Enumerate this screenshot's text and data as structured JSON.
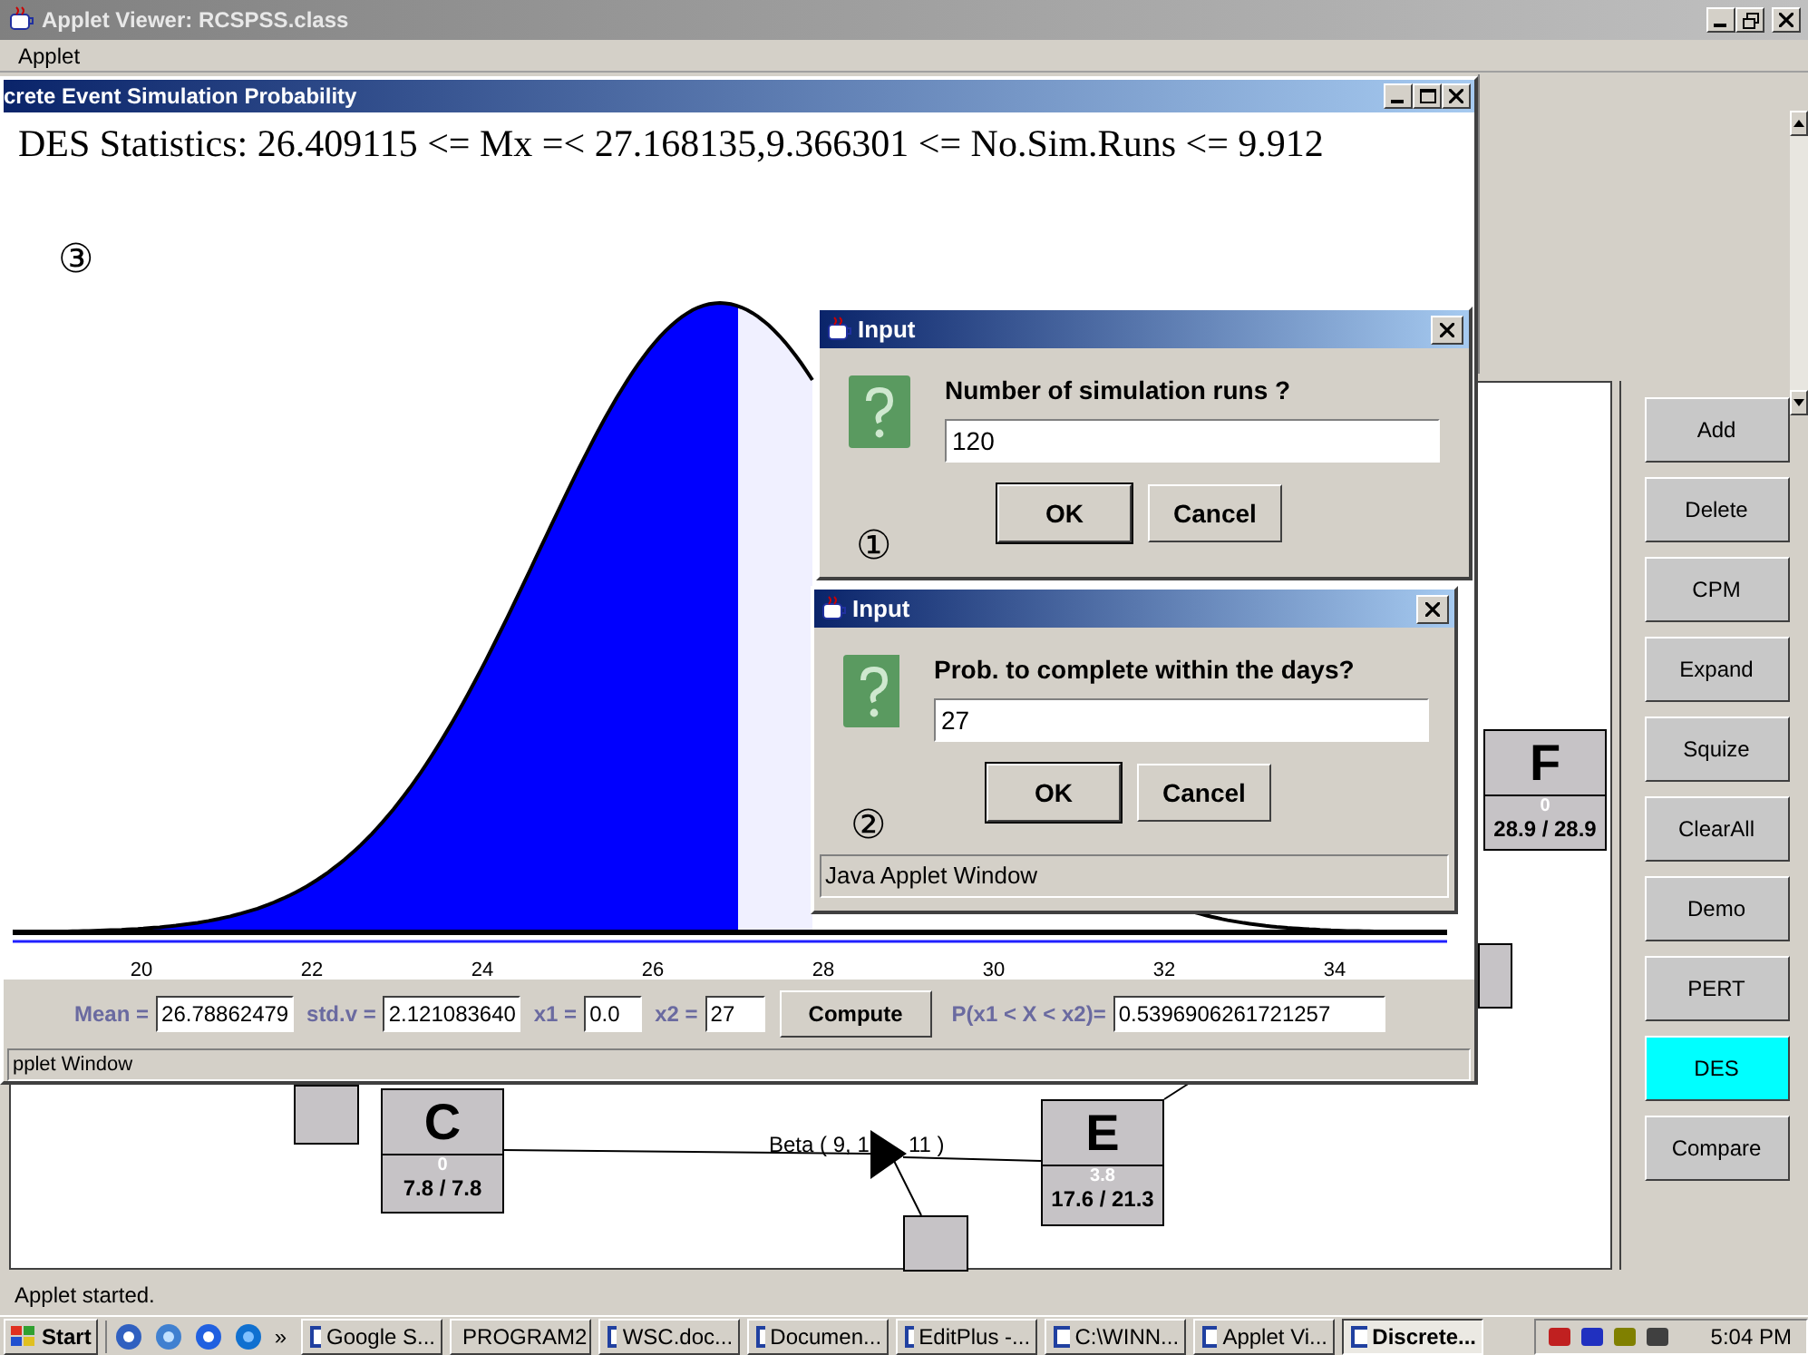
{
  "applet_viewer": {
    "title": "Applet Viewer: RCSPSS.class",
    "menu": [
      "Applet"
    ],
    "status": "Applet started."
  },
  "network": {
    "nodes": [
      {
        "label": "C",
        "value": "0",
        "times": "7.8 / 7.8"
      },
      {
        "label": "E",
        "value": "3.8",
        "times": "17.6 / 21.3"
      },
      {
        "label": "F",
        "value": "0",
        "times": "28.9 / 28.9"
      }
    ],
    "edge_label": [
      "Beta ( 9, 1",
      "11 )"
    ]
  },
  "side_buttons": [
    {
      "label": "Add",
      "selected": false
    },
    {
      "label": "Delete",
      "selected": false
    },
    {
      "label": "CPM",
      "selected": false
    },
    {
      "label": "Expand",
      "selected": false
    },
    {
      "label": "Squize",
      "selected": false
    },
    {
      "label": "ClearAll",
      "selected": false
    },
    {
      "label": "Demo",
      "selected": false
    },
    {
      "label": "PERT",
      "selected": false
    },
    {
      "label": "DES",
      "selected": true
    },
    {
      "label": "Compare",
      "selected": false
    }
  ],
  "des_window": {
    "title": "crete Event Simulation Probability",
    "statistics": "DES Statistics: 26.409115 <= Mx =< 27.168135,9.366301 <= No.Sim.Runs <= 9.912",
    "step_mark": "③",
    "x_tick_labels": [
      "20",
      "22",
      "24",
      "26",
      "28",
      "30",
      "32",
      "34"
    ],
    "controls": [
      {
        "kind": "label",
        "text": "Mean ="
      },
      {
        "kind": "field",
        "text": "26.78862479"
      },
      {
        "kind": "label",
        "text": "std.v ="
      },
      {
        "kind": "field",
        "text": "2.121083640"
      },
      {
        "kind": "label",
        "text": "x1 ="
      },
      {
        "kind": "field",
        "text": "0.0"
      },
      {
        "kind": "label",
        "text": "x2 ="
      },
      {
        "kind": "field",
        "text": "27"
      },
      {
        "kind": "button",
        "text": "Compute"
      },
      {
        "kind": "label",
        "text": "P(x1 < X < x2)="
      },
      {
        "kind": "field",
        "text": "0.5396906261721257"
      }
    ],
    "status": "pplet Window"
  },
  "dialogs": [
    {
      "title": "Input",
      "prompt": "Number of simulation runs ?",
      "value": "120",
      "buttons": [
        "OK",
        "Cancel"
      ],
      "step_mark": "①"
    },
    {
      "title": "Input",
      "prompt": "Prob. to complete within the days?",
      "value": "27",
      "buttons": [
        "OK",
        "Cancel"
      ],
      "step_mark": "②",
      "footer": "Java Applet Window"
    }
  ],
  "taskbar": {
    "start": "Start",
    "more": "»",
    "tasks": [
      {
        "label": "Google S...",
        "selected": false
      },
      {
        "label": "PROGRAM2",
        "selected": false
      },
      {
        "label": "WSC.doc...",
        "selected": false
      },
      {
        "label": "Documen...",
        "selected": false
      },
      {
        "label": "EditPlus -...",
        "selected": false
      },
      {
        "label": "C:\\WINN...",
        "selected": false
      },
      {
        "label": "Applet Vi...",
        "selected": false
      },
      {
        "label": "Discrete...",
        "selected": true
      }
    ],
    "clock": "5:04 PM"
  }
}
